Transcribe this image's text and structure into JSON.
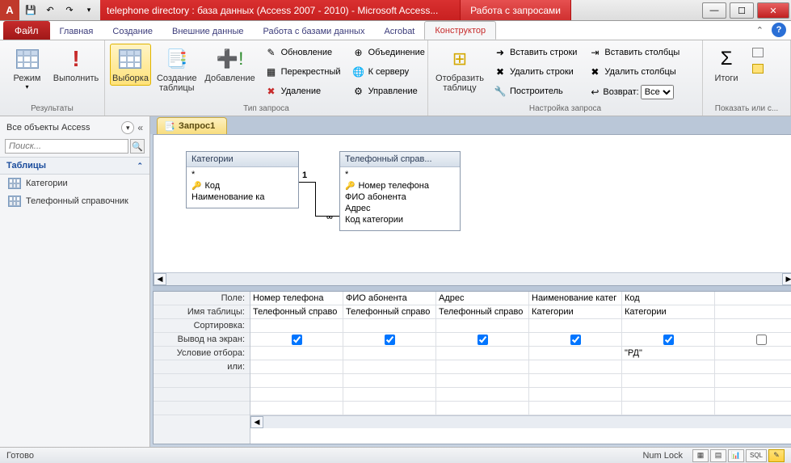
{
  "title": "telephone directory : база данных (Access 2007 - 2010)  -  Microsoft Access...",
  "context_tab": "Работа с запросами",
  "tabs": {
    "file": "Файл",
    "home": "Главная",
    "create": "Создание",
    "external": "Внешние данные",
    "dbtools": "Работа с базами данных",
    "acrobat": "Acrobat",
    "design": "Конструктор"
  },
  "ribbon": {
    "results": {
      "label": "Результаты",
      "view": "Режим",
      "run": "Выполнить"
    },
    "qtype": {
      "label": "Тип запроса",
      "select": "Выборка",
      "maketable": "Создание таблицы",
      "append": "Добавление",
      "update": "Обновление",
      "crosstab": "Перекрестный",
      "delete": "Удаление",
      "union": "Объединение",
      "passthrough": "К серверу",
      "datadef": "Управление"
    },
    "setup": {
      "label": "Настройка запроса",
      "showtable": "Отобразить таблицу",
      "insrows": "Вставить строки",
      "delrows": "Удалить строки",
      "builder": "Построитель",
      "inscols": "Вставить столбцы",
      "delcols": "Удалить столбцы",
      "return": "Возврат:",
      "return_val": "Все"
    },
    "showhide": {
      "label": "Показать или с...",
      "totals": "Итоги"
    }
  },
  "nav": {
    "title": "Все объекты Access",
    "search_ph": "Поиск...",
    "group": "Таблицы",
    "items": [
      "Категории",
      "Телефонный справочник"
    ]
  },
  "doc_tab": "Запрос1",
  "diagram": {
    "t1": {
      "title": "Категории",
      "star": "*",
      "key": "Код",
      "f1": "Наименование ка"
    },
    "t2": {
      "title": "Телефонный справ...",
      "star": "*",
      "key": "Номер телефона",
      "f1": "ФИО абонента",
      "f2": "Адрес",
      "f3": "Код категории"
    },
    "one": "1",
    "many": "∞"
  },
  "qbe": {
    "rows": {
      "field": "Поле:",
      "table": "Имя таблицы:",
      "sort": "Сортировка:",
      "show": "Вывод на экран:",
      "criteria": "Условие отбора:",
      "or": "или:"
    },
    "cols": [
      {
        "field": "Номер телефона",
        "table": "Телефонный справо",
        "show": true,
        "criteria": ""
      },
      {
        "field": "ФИО абонента",
        "table": "Телефонный справо",
        "show": true,
        "criteria": ""
      },
      {
        "field": "Адрес",
        "table": "Телефонный справо",
        "show": true,
        "criteria": ""
      },
      {
        "field": "Наименование катег",
        "table": "Категории",
        "show": true,
        "criteria": ""
      },
      {
        "field": "Код",
        "table": "Категории",
        "show": true,
        "criteria": "\"РД\""
      },
      {
        "field": "",
        "table": "",
        "show": false,
        "criteria": ""
      }
    ]
  },
  "status": {
    "ready": "Готово",
    "numlock": "Num Lock",
    "sql": "SQL"
  }
}
